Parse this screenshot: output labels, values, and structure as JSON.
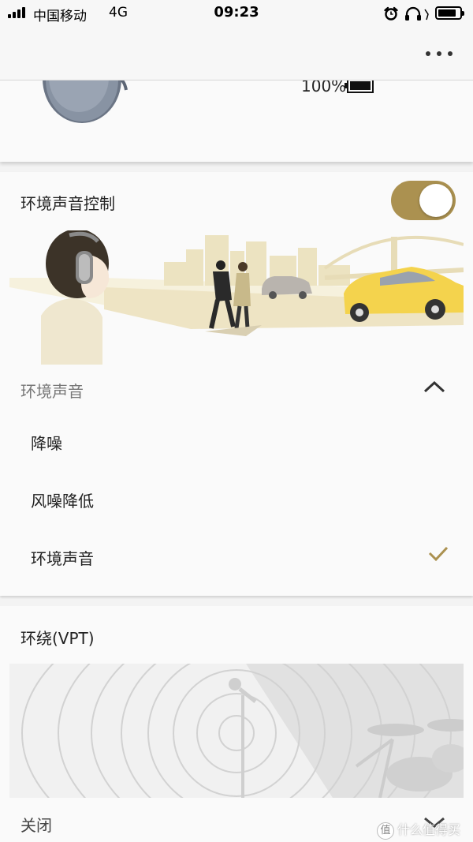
{
  "status_bar": {
    "carrier": "中国移动",
    "network": "4G",
    "time": "09:23"
  },
  "device": {
    "battery": "100%"
  },
  "ambient_sound_control": {
    "title": "环境声音控制",
    "toggle_on": true,
    "section_label": "环境声音",
    "options": [
      {
        "label": "降噪",
        "selected": false
      },
      {
        "label": "风噪降低",
        "selected": false
      },
      {
        "label": "环境声音",
        "selected": true
      }
    ]
  },
  "surround": {
    "title": "环绕(VPT)",
    "value": "关闭"
  },
  "watermark": {
    "badge": "值",
    "text": "什么值得买"
  },
  "colors": {
    "accent": "#ab9150",
    "car": "#f4d34d"
  }
}
